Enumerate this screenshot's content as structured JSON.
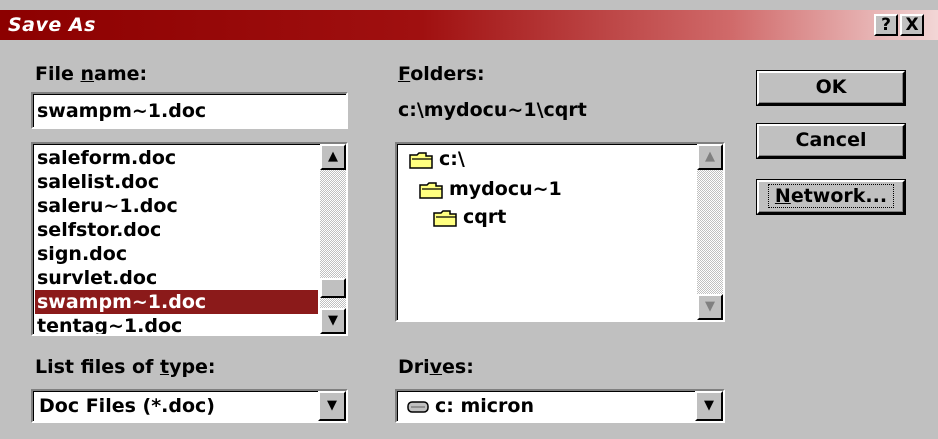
{
  "window": {
    "title": "Save As",
    "help_button": "?",
    "close_button": "X"
  },
  "file_name": {
    "label_pre": "File ",
    "label_u": "n",
    "label_post": "ame:",
    "value": "swampm~1.doc"
  },
  "file_list": {
    "items": [
      "saleform.doc",
      "salelist.doc",
      "saleru~1.doc",
      "selfstor.doc",
      "sign.doc",
      "survlet.doc",
      "swampm~1.doc",
      "tentag~1.doc"
    ],
    "selected": "swampm~1.doc"
  },
  "folders": {
    "label_u": "F",
    "label_post": "olders:",
    "current_path": "c:\\mydocu~1\\cqrt",
    "tree": [
      "c:\\",
      "mydocu~1",
      "cqrt"
    ]
  },
  "file_type": {
    "label_pre": "List files of ",
    "label_u": "t",
    "label_post": "ype:",
    "value": "Doc Files (*.doc)"
  },
  "drives": {
    "label_pre": "Dri",
    "label_u": "v",
    "label_post": "es:",
    "value": "c: micron"
  },
  "buttons": {
    "ok": "OK",
    "cancel": "Cancel",
    "network_u": "N",
    "network_post": "etwork..."
  },
  "icons": {
    "scroll_up": "up-arrow-icon",
    "scroll_down": "down-arrow-icon",
    "folder": "folder-icon",
    "drive": "hard-drive-icon"
  },
  "colors": {
    "title_bar_start": "#8c0000",
    "selection": "#8b1a1a",
    "face": "#c0c0c0"
  }
}
